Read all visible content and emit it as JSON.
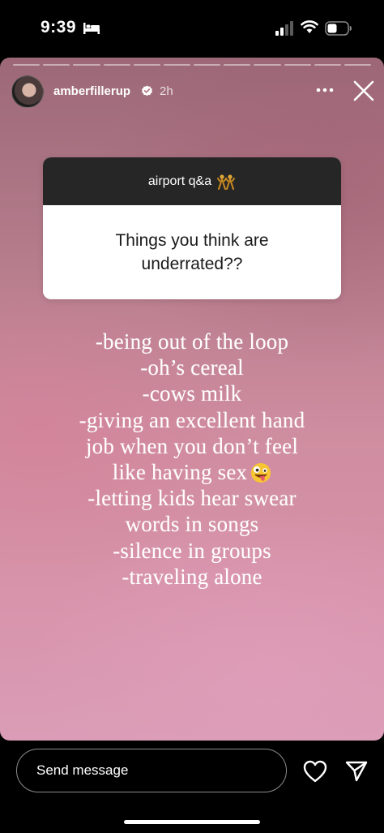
{
  "status_bar": {
    "time": "9:39",
    "icons": [
      "bed-icon",
      "signal-icon",
      "wifi-icon",
      "battery-icon"
    ]
  },
  "story": {
    "progress_segments": 12,
    "user": {
      "username": "amberfillerup",
      "verified": true,
      "time_ago": "2h"
    },
    "question_sticker": {
      "title": "airport q&a",
      "title_emoji": "dancers-emoji",
      "question": "Things you think are underrated??"
    },
    "answer_lines": [
      "-being out of the loop",
      "-oh’s cereal",
      "-cows milk",
      "-giving an excellent hand",
      "job when you don’t feel",
      "like having sex",
      "-letting kids hear swear",
      "words in songs",
      "-silence in groups",
      "-traveling alone"
    ],
    "answer_emoji": "zany-face-emoji"
  },
  "bottom_bar": {
    "message_placeholder": "Send message",
    "icons": [
      "heart-icon",
      "send-icon"
    ]
  }
}
